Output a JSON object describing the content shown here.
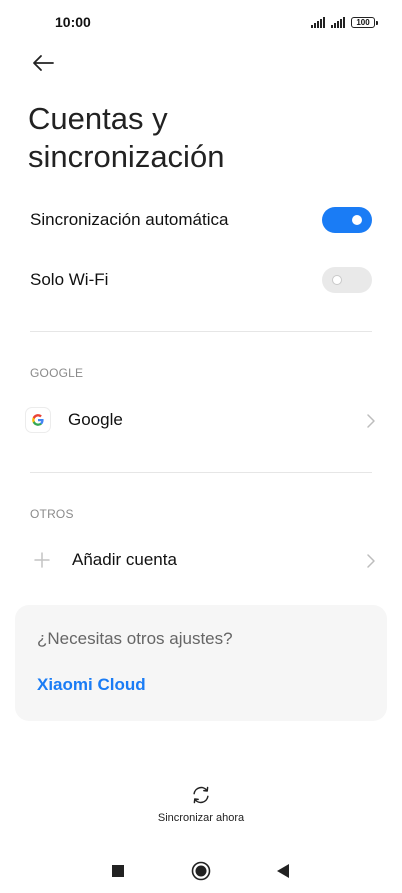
{
  "status_bar": {
    "time": "10:00",
    "battery": "100"
  },
  "header": {
    "title": "Cuentas y sincronización"
  },
  "settings": {
    "auto_sync": {
      "label": "Sincronización automática",
      "enabled": true
    },
    "wifi_only": {
      "label": "Solo Wi-Fi",
      "enabled": false
    }
  },
  "sections": {
    "google": {
      "header": "GOOGLE",
      "account_label": "Google"
    },
    "others": {
      "header": "OTROS",
      "add_account_label": "Añadir cuenta"
    }
  },
  "card": {
    "question": "¿Necesitas otros ajustes?",
    "link": "Xiaomi Cloud"
  },
  "sync_now": {
    "label": "Sincronizar ahora"
  },
  "colors": {
    "accent": "#1a7cf5",
    "card_bg": "#f6f6f6"
  },
  "icons": {
    "back": "arrow-left-icon",
    "google": "google-icon",
    "add": "plus-icon",
    "chevron": "chevron-right-icon",
    "sync": "sync-icon",
    "nav_recents": "square-icon",
    "nav_home": "circle-icon",
    "nav_back": "triangle-left-icon"
  }
}
